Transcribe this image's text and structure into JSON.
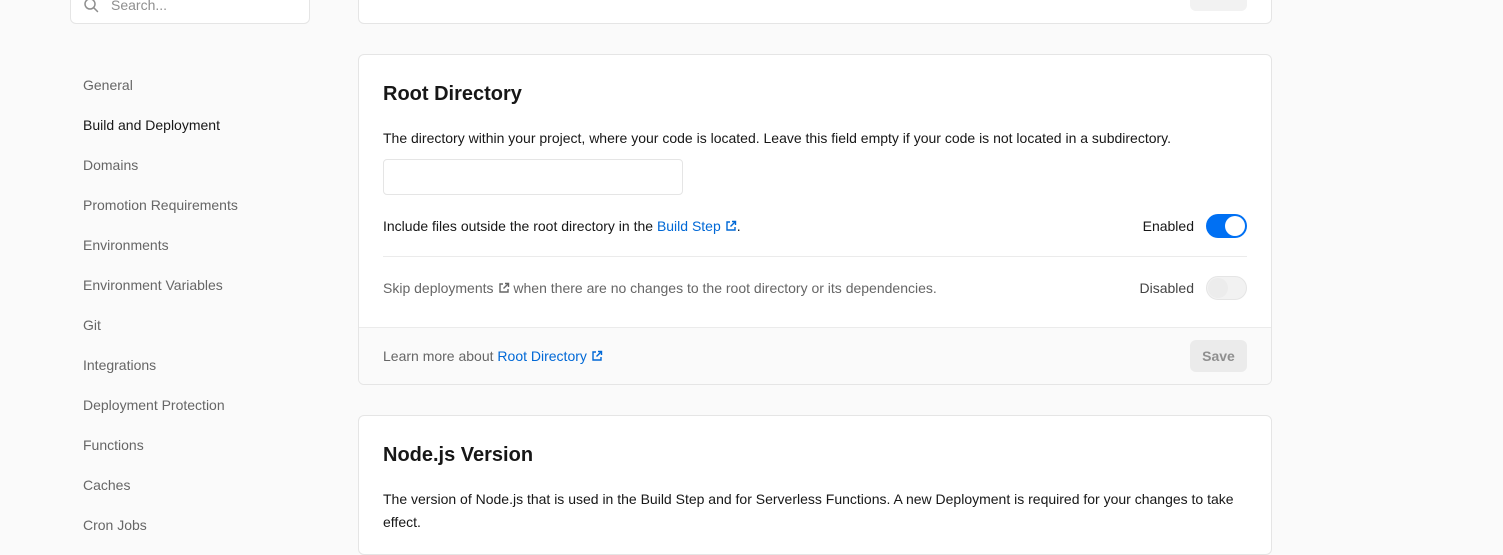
{
  "search": {
    "placeholder": "Search..."
  },
  "sidebar": {
    "items": [
      {
        "label": "General"
      },
      {
        "label": "Build and Deployment"
      },
      {
        "label": "Domains"
      },
      {
        "label": "Promotion Requirements"
      },
      {
        "label": "Environments"
      },
      {
        "label": "Environment Variables"
      },
      {
        "label": "Git"
      },
      {
        "label": "Integrations"
      },
      {
        "label": "Deployment Protection"
      },
      {
        "label": "Functions"
      },
      {
        "label": "Caches"
      },
      {
        "label": "Cron Jobs"
      }
    ],
    "active_index": 1
  },
  "root_directory": {
    "title": "Root Directory",
    "description": "The directory within your project, where your code is located. Leave this field empty if your code is not located in a subdirectory.",
    "input_value": "",
    "include_files": {
      "prefix": "Include files outside the root directory in the",
      "link": "Build Step",
      "suffix": ".",
      "status": "Enabled",
      "enabled": true
    },
    "skip_deployments": {
      "link": "Skip deployments",
      "suffix": "when there are no changes to the root directory or its dependencies.",
      "status": "Disabled",
      "enabled": false
    },
    "footer": {
      "prefix": "Learn more about",
      "link": "Root Directory",
      "save_label": "Save"
    }
  },
  "node_version": {
    "title": "Node.js Version",
    "description": "The version of Node.js that is used in the Build Step and for Serverless Functions. A new Deployment is required for your changes to take effect."
  },
  "colors": {
    "accent": "#0070f3",
    "link": "#0068d6",
    "muted_text": "#666666"
  }
}
